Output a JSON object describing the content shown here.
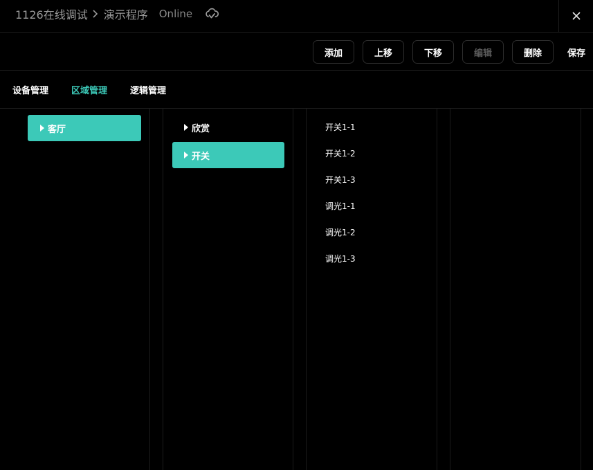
{
  "header": {
    "project": "1126在线调试",
    "program": "演示程序",
    "status": "Online"
  },
  "toolbar": {
    "add": "添加",
    "move_up": "上移",
    "move_down": "下移",
    "edit": "编辑",
    "delete": "删除",
    "save": "保存"
  },
  "tabs": [
    "设备管理",
    "区域管理",
    "逻辑管理"
  ],
  "columns": {
    "areas": [
      "客厅"
    ],
    "groups": [
      "欣赏",
      "开关"
    ],
    "devices": [
      "开关1-1",
      "开关1-2",
      "开关1-3",
      "调光1-1",
      "调光1-2",
      "调光1-3"
    ]
  },
  "colors": {
    "accent": "#3cc9b8",
    "background": "#000000"
  }
}
